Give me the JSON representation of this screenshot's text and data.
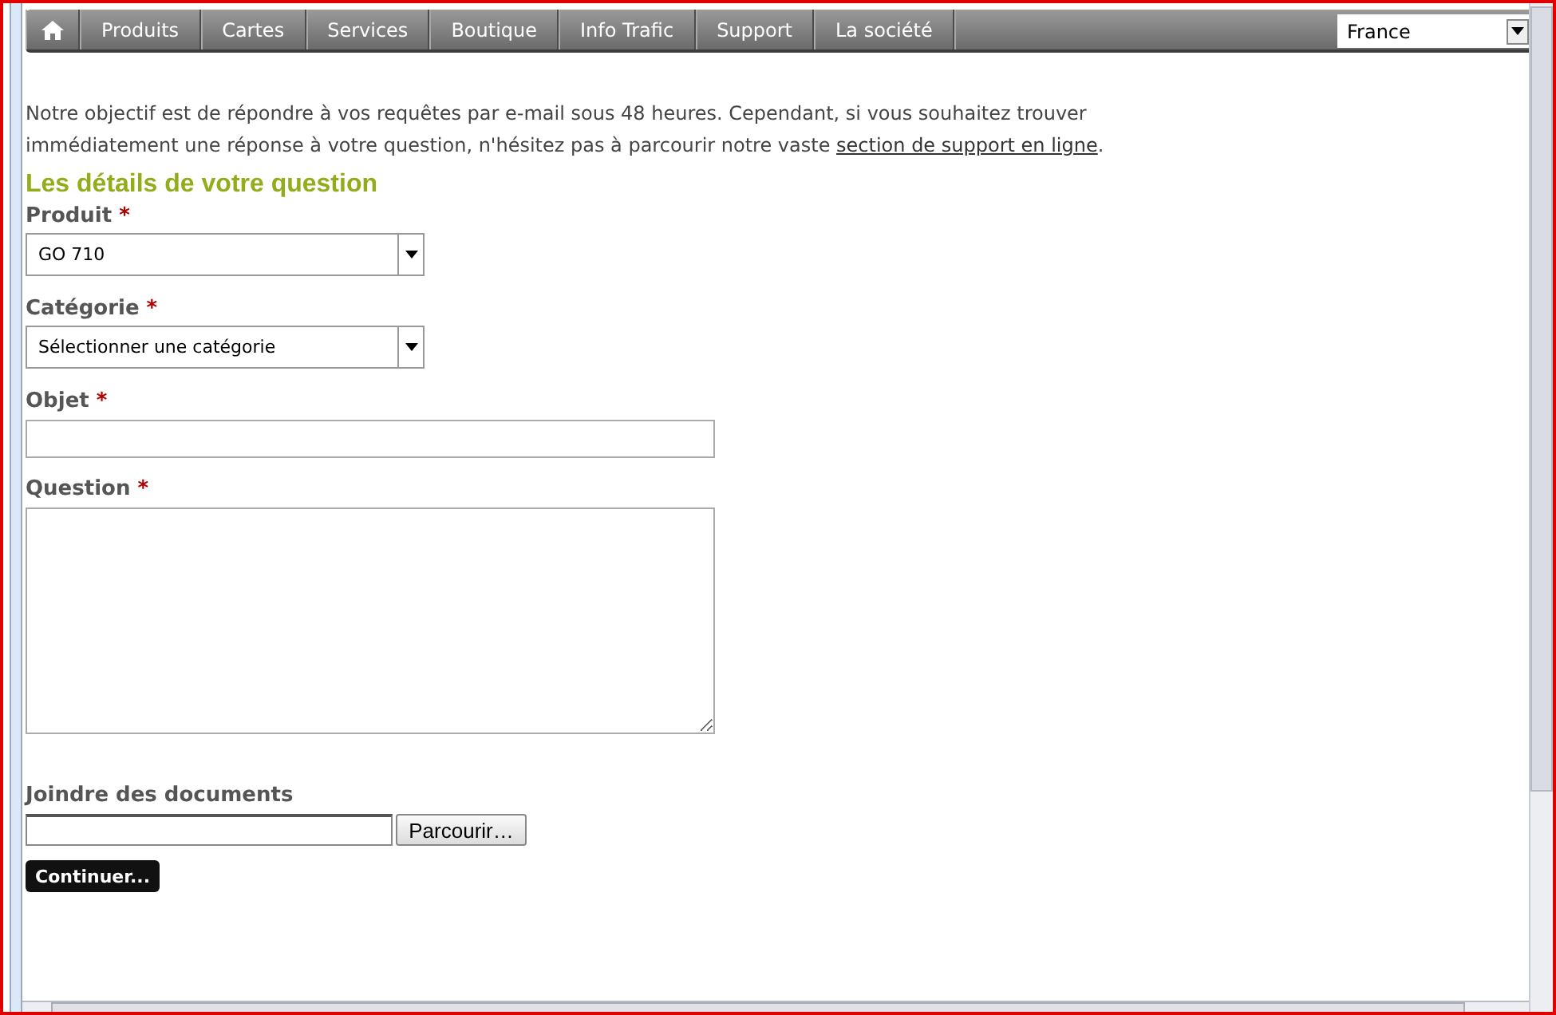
{
  "nav": {
    "items": [
      {
        "label": "Produits"
      },
      {
        "label": "Cartes"
      },
      {
        "label": "Services"
      },
      {
        "label": "Boutique"
      },
      {
        "label": "Info Trafic"
      },
      {
        "label": "Support"
      },
      {
        "label": "La société"
      }
    ],
    "country": "France"
  },
  "intro": {
    "text": "Notre objectif est de répondre à vos requêtes par e-mail sous 48 heures. Cependant, si vous souhaitez trouver immédiatement une réponse à votre question, n'hésitez pas à parcourir notre vaste ",
    "link": "section de support en ligne",
    "after": "."
  },
  "section_title": "Les détails de votre question",
  "fields": [
    {
      "kind": "select",
      "label": "Produit",
      "mark": "*",
      "value": "GO 710"
    },
    {
      "kind": "select",
      "label": "Catégorie",
      "mark": "*",
      "value": "Sélectionner une catégorie"
    },
    {
      "kind": "input",
      "label": "Objet",
      "mark": "*"
    },
    {
      "kind": "textarea",
      "label": "Question",
      "mark": "*"
    }
  ],
  "attachment": {
    "label": "Joindre des documents",
    "button": "Parcourir…"
  },
  "submit": "Continuer..."
}
